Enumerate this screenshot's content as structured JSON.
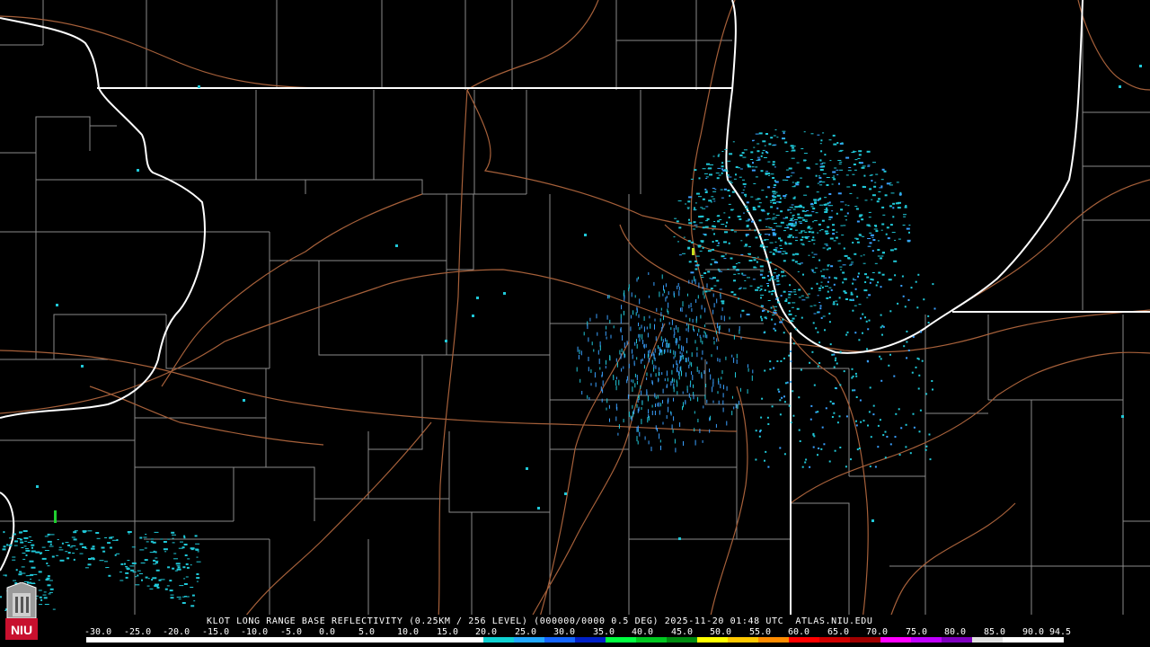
{
  "caption": "KLOT LONG RANGE BASE REFLECTIVITY (0.25KM / 256 LEVEL) (000000/0000 0.5 DEG) 2025-11-20 01:48 UTC  ATLAS.NIU.EDU",
  "logo_text": "NIU",
  "colors": {
    "background": "#000000",
    "state_border": "#ffffff",
    "county_line": "#8a8a8a",
    "highway": "#b0663f",
    "echo_light": "#20c8d8",
    "echo_medium": "#3aa0ff",
    "echo_strong": "#c8e020",
    "echo_green": "#20d030"
  },
  "scale": {
    "labels": [
      "-30.0",
      "-25.0",
      "-20.0",
      "-15.0",
      "-10.0",
      "-5.0",
      "0.0",
      "5.0",
      "10.0",
      "15.0",
      "20.0",
      "25.0",
      "30.0",
      "35.0",
      "40.0",
      "45.0",
      "50.0",
      "55.0",
      "60.0",
      "65.0",
      "70.0",
      "75.0",
      "80.0",
      "85.0",
      "90.0",
      "94.5"
    ],
    "colors": [
      "#ffffff",
      "#ffffff",
      "#ffffff",
      "#ffffff",
      "#ffffff",
      "#ffffff",
      "#ffffff",
      "#ffffff",
      "#ffffff",
      "#ffffff",
      "#ffffff",
      "#ffffff",
      "#ffffff",
      "#0fd2d2",
      "#21a8ff",
      "#1565ff",
      "#0020c8",
      "#00ff40",
      "#00c820",
      "#008c10",
      "#ffff00",
      "#ffc800",
      "#ff8c00",
      "#ff0000",
      "#d00000",
      "#a00000",
      "#ff00ff",
      "#c000ff",
      "#8000c0",
      "#e0e0e0",
      "#ffffff",
      "#ffffff"
    ]
  }
}
